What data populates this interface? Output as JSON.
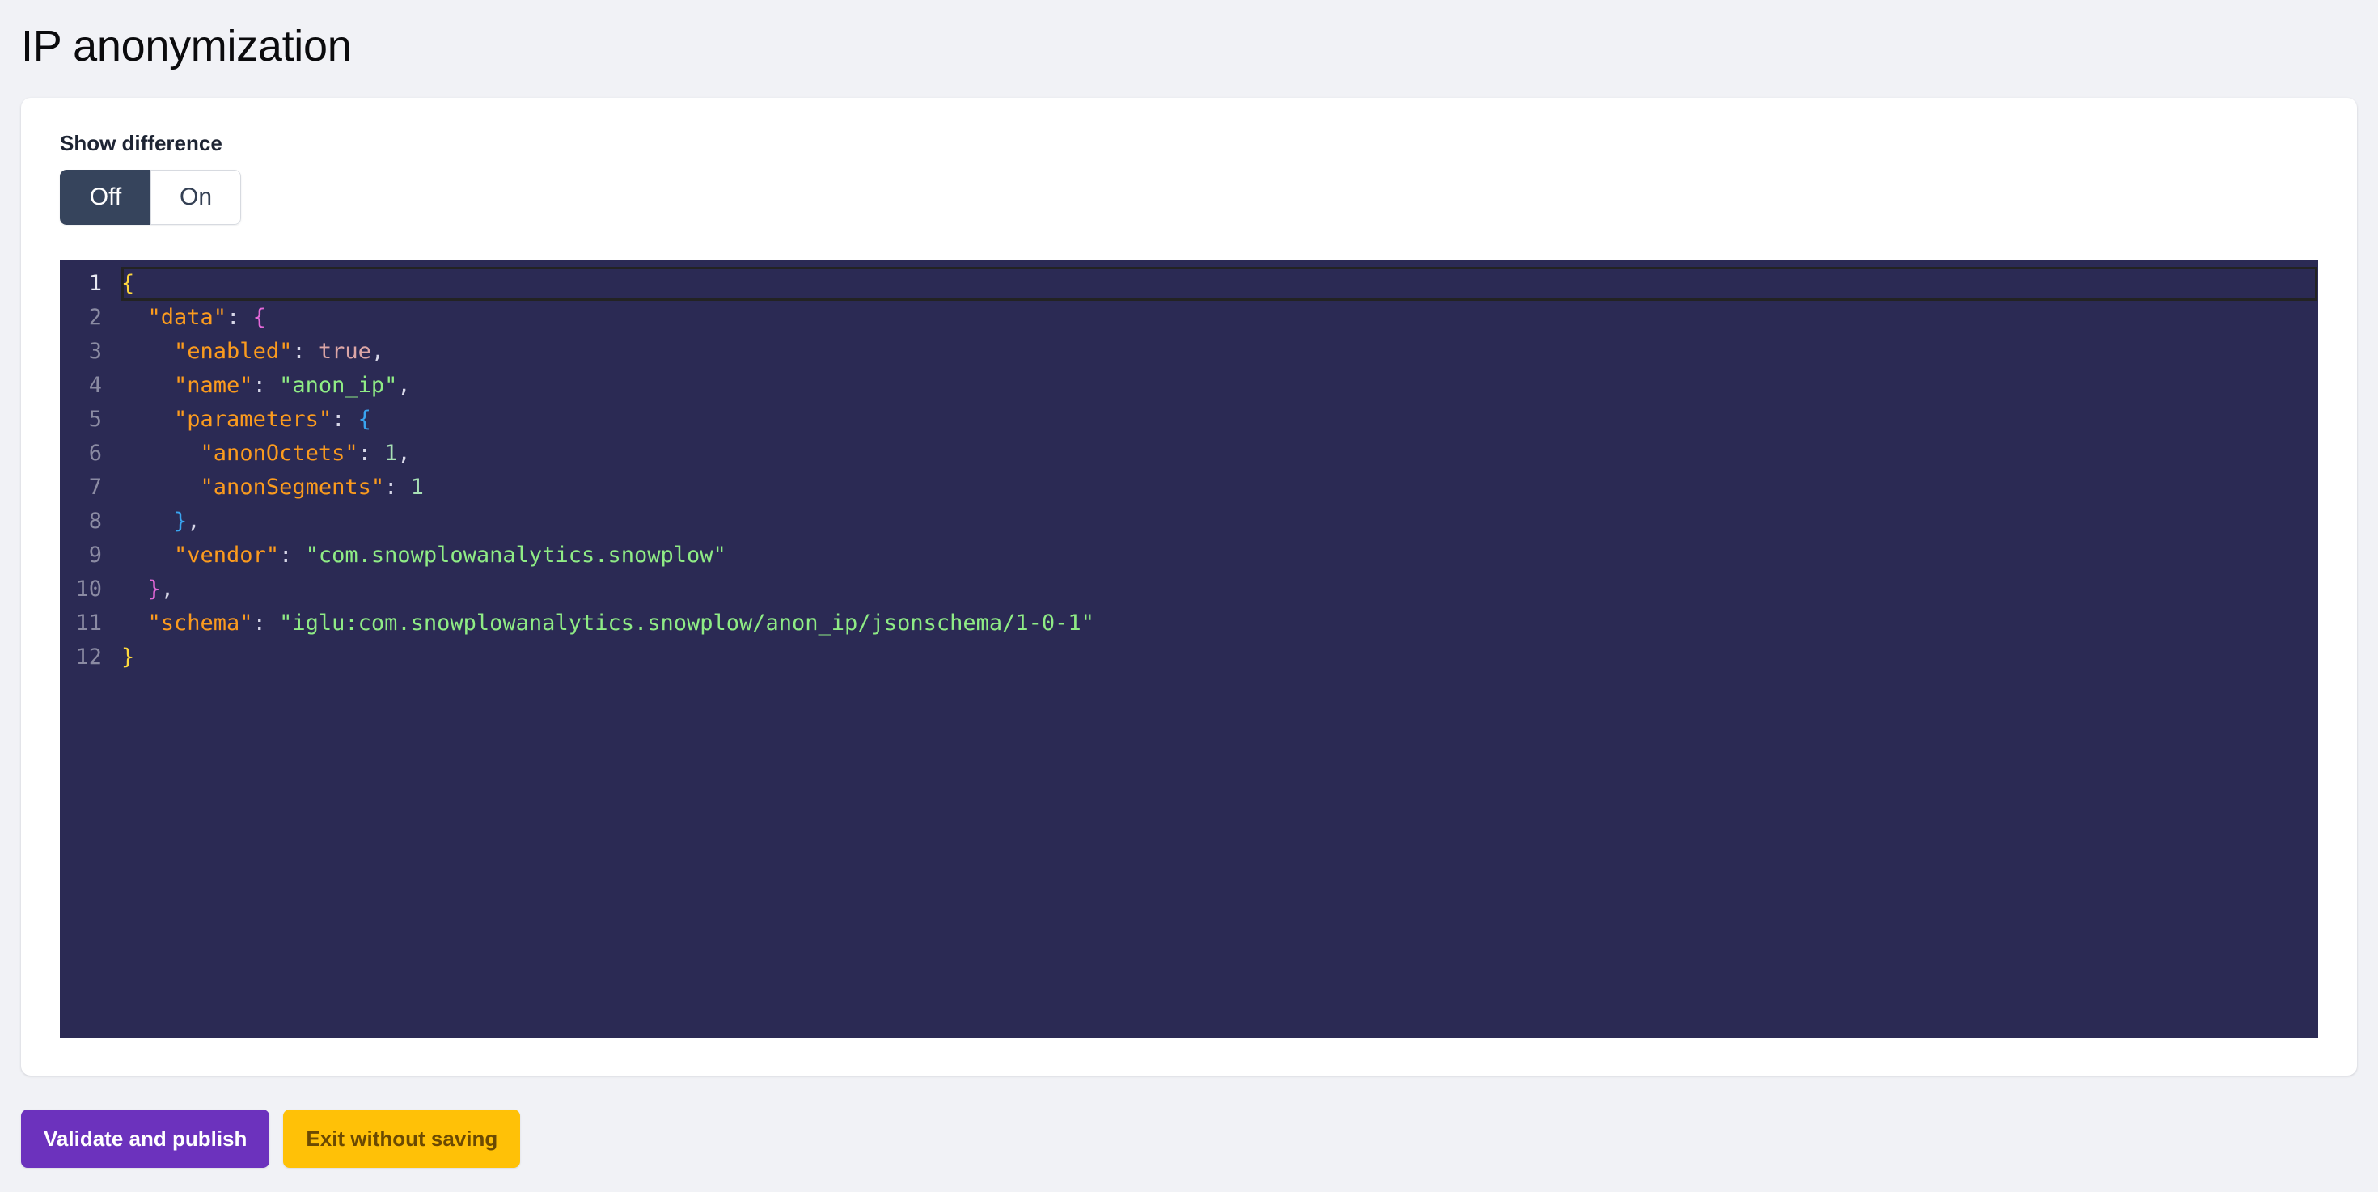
{
  "page": {
    "title": "IP anonymization",
    "background_color": "#f1f2f6"
  },
  "card": {
    "show_difference": {
      "label": "Show difference",
      "selected": "Off",
      "options": [
        {
          "label": "Off",
          "active": true
        },
        {
          "label": "On",
          "active": false
        }
      ]
    },
    "editor": {
      "language": "json",
      "background_color": "#2b2a54",
      "active_line": 1,
      "total_lines": 12,
      "lines": [
        {
          "num": "1",
          "indent": 0,
          "tokens": [
            {
              "t": "br1",
              "v": "{"
            }
          ]
        },
        {
          "num": "2",
          "indent": 1,
          "tokens": [
            {
              "t": "key",
              "v": "\"data\""
            },
            {
              "t": "punc",
              "v": ": "
            },
            {
              "t": "br2",
              "v": "{"
            }
          ]
        },
        {
          "num": "3",
          "indent": 2,
          "tokens": [
            {
              "t": "key",
              "v": "\"enabled\""
            },
            {
              "t": "punc",
              "v": ": "
            },
            {
              "t": "bool",
              "v": "true"
            },
            {
              "t": "punc",
              "v": ","
            }
          ]
        },
        {
          "num": "4",
          "indent": 2,
          "tokens": [
            {
              "t": "key",
              "v": "\"name\""
            },
            {
              "t": "punc",
              "v": ": "
            },
            {
              "t": "str",
              "v": "\"anon_ip\""
            },
            {
              "t": "punc",
              "v": ","
            }
          ]
        },
        {
          "num": "5",
          "indent": 2,
          "tokens": [
            {
              "t": "key",
              "v": "\"parameters\""
            },
            {
              "t": "punc",
              "v": ": "
            },
            {
              "t": "br3",
              "v": "{"
            }
          ]
        },
        {
          "num": "6",
          "indent": 3,
          "tokens": [
            {
              "t": "key",
              "v": "\"anonOctets\""
            },
            {
              "t": "punc",
              "v": ": "
            },
            {
              "t": "num",
              "v": "1"
            },
            {
              "t": "punc",
              "v": ","
            }
          ]
        },
        {
          "num": "7",
          "indent": 3,
          "tokens": [
            {
              "t": "key",
              "v": "\"anonSegments\""
            },
            {
              "t": "punc",
              "v": ": "
            },
            {
              "t": "num",
              "v": "1"
            }
          ]
        },
        {
          "num": "8",
          "indent": 2,
          "tokens": [
            {
              "t": "br3",
              "v": "}"
            },
            {
              "t": "punc",
              "v": ","
            }
          ]
        },
        {
          "num": "9",
          "indent": 2,
          "tokens": [
            {
              "t": "key",
              "v": "\"vendor\""
            },
            {
              "t": "punc",
              "v": ": "
            },
            {
              "t": "str",
              "v": "\"com.snowplowanalytics.snowplow\""
            }
          ]
        },
        {
          "num": "10",
          "indent": 1,
          "tokens": [
            {
              "t": "br2",
              "v": "}"
            },
            {
              "t": "punc",
              "v": ","
            }
          ]
        },
        {
          "num": "11",
          "indent": 1,
          "tokens": [
            {
              "t": "key",
              "v": "\"schema\""
            },
            {
              "t": "punc",
              "v": ": "
            },
            {
              "t": "str",
              "v": "\"iglu:com.snowplowanalytics.snowplow/anon_ip/jsonschema/1-0-1\""
            }
          ]
        },
        {
          "num": "12",
          "indent": 0,
          "tokens": [
            {
              "t": "br1",
              "v": "}"
            }
          ]
        }
      ],
      "document_text": "{\n  \"data\": {\n    \"enabled\": true,\n    \"name\": \"anon_ip\",\n    \"parameters\": {\n      \"anonOctets\": 1,\n      \"anonSegments\": 1\n    },\n    \"vendor\": \"com.snowplowanalytics.snowplow\"\n  },\n  \"schema\": \"iglu:com.snowplowanalytics.snowplow/anon_ip/jsonschema/1-0-1\"\n}"
    }
  },
  "actions": {
    "primary": {
      "label": "Validate and publish",
      "color": "#6c32bd"
    },
    "secondary": {
      "label": "Exit without saving",
      "color": "#ffc107"
    }
  }
}
